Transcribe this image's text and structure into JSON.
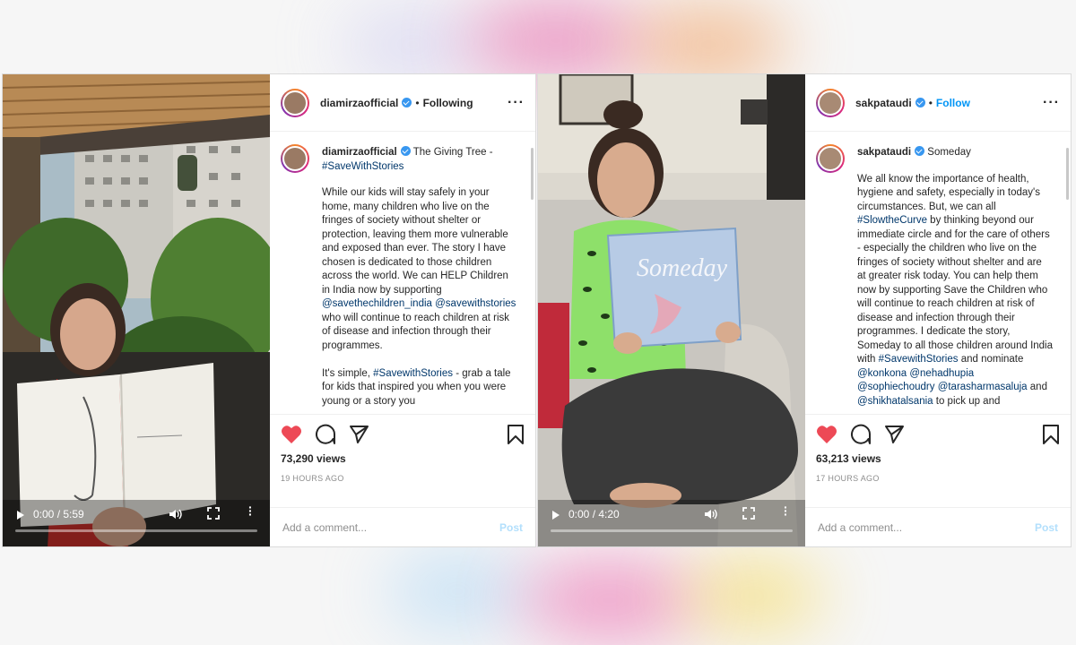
{
  "posts": [
    {
      "username": "diamirzaofficial",
      "follow_status": "Following",
      "caption_title": "The Giving Tree -",
      "caption_title_tag": "#SaveWithStories",
      "caption_parts": [
        {
          "t": "While our kids will stay safely in your home, many children who live on the fringes of society without shelter or protection, leaving them more vulnerable and exposed than ever. The story I have chosen is dedicated to those children across the world. We can HELP Children in India now by supporting "
        },
        {
          "t": "@savethechildren_india",
          "tag": true
        },
        {
          "t": " "
        },
        {
          "t": "@savewithstories",
          "tag": true
        },
        {
          "t": " who will continue to reach children at risk of disease and infection through their programmes.\n\nIt's simple, "
        },
        {
          "t": "#SavewithStories",
          "tag": true
        },
        {
          "t": " - grab a tale for kids that inspired you when you were young or a story you"
        }
      ],
      "views": "73,290 views",
      "time": "19 HOURS AGO",
      "comment_placeholder": "Add a comment...",
      "post_label": "Post",
      "video_time": "0:00 / 5:59"
    },
    {
      "username": "sakpataudi",
      "follow_status": "Follow",
      "caption_title": "Someday",
      "caption_title_tag": "",
      "caption_parts": [
        {
          "t": "We all know the importance of health, hygiene and safety, especially in today's circumstances. But, we can all "
        },
        {
          "t": "#SlowtheCurve",
          "tag": true
        },
        {
          "t": " by thinking beyond our immediate circle and for the care of others - especially the children who live on the fringes of society without shelter and are at greater risk today. You can help them now by supporting Save the Children who will continue to reach children at risk of disease and infection through their programmes. I dedicate the story, Someday to all those children around India with "
        },
        {
          "t": "#SavewithStories",
          "tag": true
        },
        {
          "t": " and nominate "
        },
        {
          "t": "@konkona",
          "tag": true
        },
        {
          "t": " "
        },
        {
          "t": "@nehadhupia",
          "tag": true
        },
        {
          "t": " "
        },
        {
          "t": "@sophiechoudry",
          "tag": true
        },
        {
          "t": " "
        },
        {
          "t": "@tarasharmasaluja",
          "tag": true
        },
        {
          "t": " and "
        },
        {
          "t": "@shikhatalsania",
          "tag": true
        },
        {
          "t": " to pick up and"
        }
      ],
      "views": "63,213 views",
      "time": "17 HOURS AGO",
      "comment_placeholder": "Add a comment...",
      "post_label": "Post",
      "video_time": "0:00 / 4:20",
      "book_title": "Someday"
    }
  ],
  "colors": {
    "like_red": "#ed4956",
    "link_blue": "#00376b",
    "follow_blue": "#0095f6"
  },
  "icons": [
    "heart-icon",
    "comment-icon",
    "share-icon",
    "bookmark-icon",
    "play-icon",
    "volume-icon",
    "fullscreen-icon",
    "more-icon",
    "verified-icon"
  ]
}
